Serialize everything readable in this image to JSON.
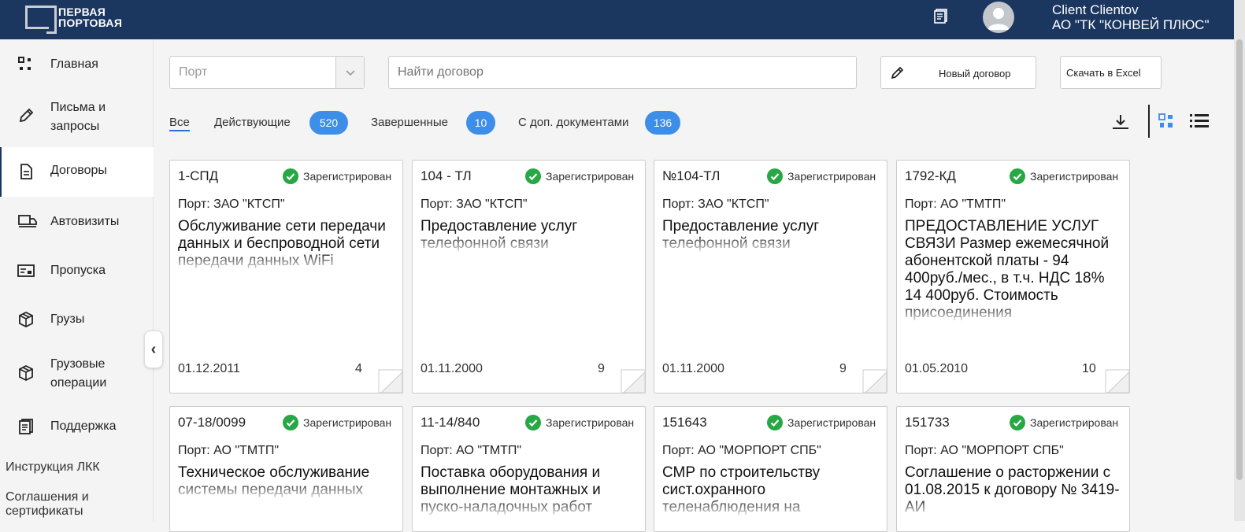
{
  "header": {
    "logo_line1": "ПЕРВАЯ",
    "logo_line2": "ПОРТОВАЯ",
    "user_name": "Client Clientov",
    "user_org": "АО \"ТК \"КОНВЕЙ ПЛЮС\"",
    "bg_color": "#1b365f"
  },
  "sidebar": {
    "items": [
      {
        "label": "Главная",
        "icon": "dashboard-icon"
      },
      {
        "label_line1": "Письма и",
        "label_line2": "запросы",
        "icon": "pencil-icon"
      },
      {
        "label": "Договоры",
        "icon": "document-icon",
        "active": true
      },
      {
        "label": "Автовизиты",
        "icon": "truck-icon"
      },
      {
        "label": "Пропуска",
        "icon": "pass-card-icon"
      },
      {
        "label": "Грузы",
        "icon": "box-icon"
      },
      {
        "label_line1": "Грузовые",
        "label_line2": "операции",
        "icon": "box-icon"
      },
      {
        "label": "Поддержка",
        "icon": "notes-icon"
      }
    ],
    "links": [
      {
        "label": "Инструкция ЛКК"
      },
      {
        "label_line1": "Соглашения и",
        "label_line2": "сертификаты"
      }
    ],
    "collapse_label": "‹"
  },
  "toolbar": {
    "port_placeholder": "Порт",
    "search_placeholder": "Найти договор",
    "new_contract_label": "Новый договор",
    "excel_label": "Скачать в Excel"
  },
  "tabs": [
    {
      "label": "Все",
      "active": true
    },
    {
      "label": "Действующие",
      "count": "520"
    },
    {
      "label": "Завершенные",
      "count": "10"
    },
    {
      "label": "С доп. документами",
      "count": "136"
    }
  ],
  "accent_color": "#3d8ee8",
  "status_color": "#27a844",
  "cards": [
    {
      "num": "1-СПД",
      "status": "Зарегистрирован",
      "port": "Порт: ЗАО \"КТСП\"",
      "title": "Обслуживание сети передачи данных и беспроводной сети передачи данных WiFi",
      "date": "01.12.2011",
      "count": "4"
    },
    {
      "num": "104 - ТЛ",
      "status": "Зарегистрирован",
      "port": "Порт: ЗАО \"КТСП\"",
      "title": "Предоставление услуг телефонной связи",
      "date": "01.11.2000",
      "count": "9"
    },
    {
      "num": "№104-ТЛ",
      "status": "Зарегистрирован",
      "port": "Порт: ЗАО \"КТСП\"",
      "title": "Предоставление услуг телефонной связи",
      "date": "01.11.2000",
      "count": "9"
    },
    {
      "num": "1792-КД",
      "status": "Зарегистрирован",
      "port": "Порт: АО \"ТМТП\"",
      "title": "ПРЕДОСТАВЛЕНИЕ УСЛУГ СВЯЗИ Размер ежемесячной абонентской платы - 94 400руб./мес., в т.ч. НДС 18% 14 400руб. Стоимость присоединения",
      "date": "01.05.2010",
      "count": "10"
    },
    {
      "num": "07-18/0099",
      "status": "Зарегистрирован",
      "port": "Порт: АО \"ТМТП\"",
      "title": "Техническое обслуживание системы передачи данных"
    },
    {
      "num": "11-14/840",
      "status": "Зарегистрирован",
      "port": "Порт: АО \"ТМТП\"",
      "title": "Поставка оборудования и выполнение монтажных и пуско-наладочных работ"
    },
    {
      "num": "151643",
      "status": "Зарегистрирован",
      "port": "Порт: АО \"МОРПОРТ СПБ\"",
      "title": "СМР по строительству сист.охранного теленаблюдения на"
    },
    {
      "num": "151733",
      "status": "Зарегистрирован",
      "port": "Порт: АО \"МОРПОРТ СПБ\"",
      "title": "Соглашение о расторжении с 01.08.2015 к договору № 3419-АИ"
    }
  ]
}
